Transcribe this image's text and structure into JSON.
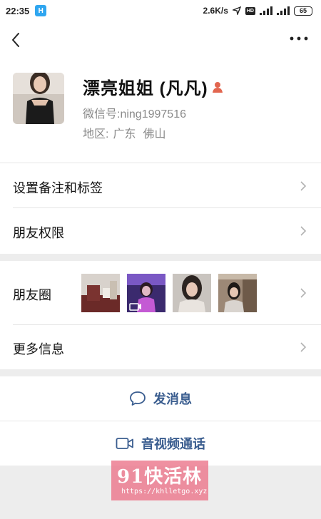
{
  "status_bar": {
    "time": "22:35",
    "app_badge": "H",
    "net_speed": "2.6K/s",
    "hd": "HD",
    "battery": "65"
  },
  "profile": {
    "name": "漂亮姐姐 (凡凡)",
    "wechat_id_label": "微信号:",
    "wechat_id": "ning1997516",
    "region_label": "地区:",
    "region_province": "广东",
    "region_city": "佛山"
  },
  "menu": {
    "remark_tags": "设置备注和标签",
    "permissions": "朋友权限",
    "moments": "朋友圈",
    "more_info": "更多信息"
  },
  "actions": {
    "send_message": "发消息",
    "av_call": "音视频通话"
  },
  "watermark": {
    "title": "91快活林",
    "url": "https://khlletgo.xyz"
  },
  "colors": {
    "accent": "#3a5d8f",
    "background": "#ededed",
    "gender_icon": "#e2664f",
    "watermark": "#eb788c"
  },
  "icons": [
    "back-icon",
    "more-icon",
    "gender-icon",
    "chevron-right-icon",
    "chat-bubble-icon",
    "video-camera-icon"
  ]
}
